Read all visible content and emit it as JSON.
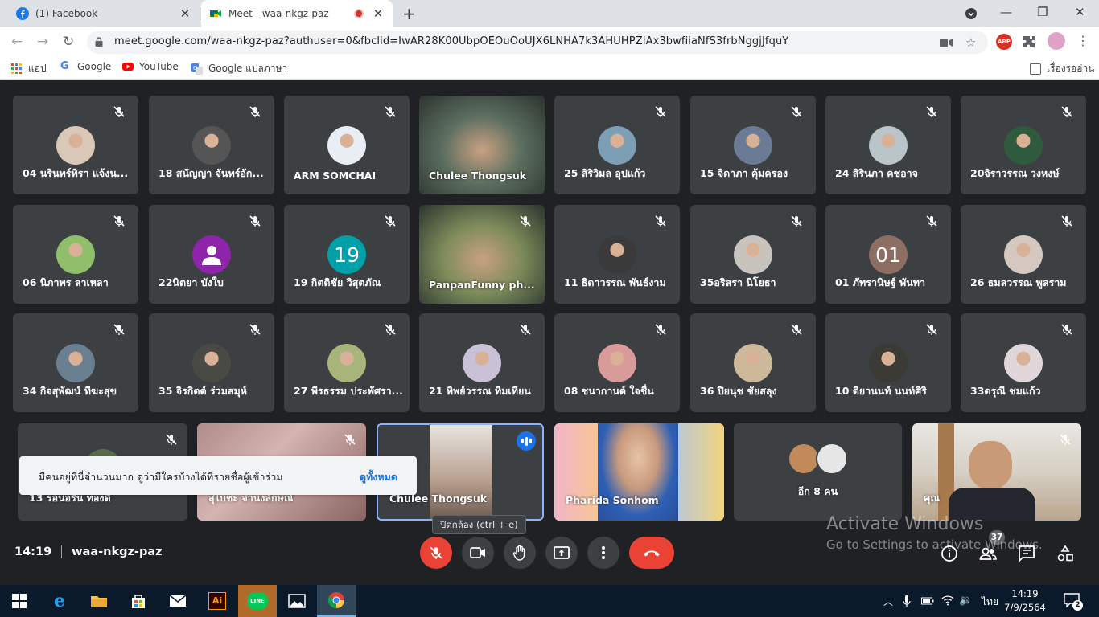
{
  "browser": {
    "tabs": [
      {
        "title": "(1) Facebook"
      },
      {
        "title": "Meet - waa-nkgz-paz"
      }
    ],
    "url": "meet.google.com/waa-nkgz-paz?authuser=0&fbclid=IwAR28K00UbpOEOuOoUJX6LNHA7k3AHUHPZIAx3bwfiiaNfS3frbNggjJfquY",
    "bookmarks": [
      "แอป",
      "Google",
      "YouTube",
      "Google แปลภาษา"
    ],
    "reading_list": "เรื่องรออ่าน",
    "extension_badge": "ABP"
  },
  "participants": [
    {
      "name": "04 นรินทร์ทิรา แจ้งน...",
      "avatar": "photo",
      "color": "#d9c7b8"
    },
    {
      "name": "18 สนัญญา จันทร์อัก...",
      "avatar": "photo",
      "color": "#555555"
    },
    {
      "name": "ARM SOMCHAI",
      "avatar": "photo",
      "color": "#e9eef5"
    },
    {
      "name": "Chulee Thongsuk",
      "avatar": "video",
      "color": "#5b6e5f"
    },
    {
      "name": "25 สิริวิมล อุปแก้ว",
      "avatar": "photo",
      "color": "#7d9fb6"
    },
    {
      "name": "15 จิดาภา คุ้มครอง",
      "avatar": "photo",
      "color": "#6b7b95"
    },
    {
      "name": "24 สิรินภา คชอาจ",
      "avatar": "photo",
      "color": "#b9c5c9"
    },
    {
      "name": "20จิราวรรณ วงหงษ์",
      "avatar": "photo",
      "color": "#2f5a3d"
    },
    {
      "name": "06 นิภาพร ลาเหลา",
      "avatar": "photo",
      "color": "#8fbf6a"
    },
    {
      "name": "22นิตยา บังใบ",
      "avatar": "icon",
      "color": "#8e24aa"
    },
    {
      "name": "19 กิตติชัย วิสุตภัณ",
      "avatar": "19",
      "color": "#00a0a8"
    },
    {
      "name": "PanpanFunny ph...",
      "avatar": "video",
      "color": "#7d8b5a"
    },
    {
      "name": "11 ธิดาวรรณ พันธ์งาม",
      "avatar": "photo",
      "color": "#3a3a3a"
    },
    {
      "name": "35อริสรา นิโยธา",
      "avatar": "photo",
      "color": "#c9c3bd"
    },
    {
      "name": "01 ภัทรานิษฐ์ พันทา",
      "avatar": "01",
      "color": "#8d6e63"
    },
    {
      "name": "26 ธมลวรรณ พูลราม",
      "avatar": "photo",
      "color": "#d5c8c0"
    },
    {
      "name": "34 กิจสุพัฒน์ ทีฆะสุข",
      "avatar": "photo",
      "color": "#6a7f8f"
    },
    {
      "name": "35 จิรกิตต์ ร่วมสมุห์",
      "avatar": "photo",
      "color": "#4a4a44"
    },
    {
      "name": "27 พีรธรรม ประพัศรา...",
      "avatar": "photo",
      "color": "#a8b57a"
    },
    {
      "name": "21 ทิพย์วรรณ ทิมเทียน",
      "avatar": "photo",
      "color": "#c9c1d6"
    },
    {
      "name": "08 ชนากานต์ ใจชื่น",
      "avatar": "photo",
      "color": "#d99a9a"
    },
    {
      "name": "36 ปิยนุช ชัยสลุง",
      "avatar": "photo",
      "color": "#cdb89a"
    },
    {
      "name": "10 ติยานนท์ นนท์ศิริ",
      "avatar": "photo",
      "color": "#3b3b35"
    },
    {
      "name": "33ดรุณี ชมแก้ว",
      "avatar": "photo",
      "color": "#e1d6da"
    }
  ],
  "bottom_row": {
    "tile1": "13 รอนอริน ทองดี",
    "tile2": "สุไบชะ จำนงลักษณ์",
    "tile3": "Chulee Thongsuk",
    "tile4": "Pharida Sonhom",
    "tile5": "อีก 8 คน",
    "tile6": "คุณ"
  },
  "toast": {
    "message": "มีคนอยู่ที่นี่จำนวนมาก ดูว่ามีใครบ้างได้ที่รายชื่อผู้เข้าร่วม",
    "action": "ดูทั้งหมด"
  },
  "tooltip": "ปิดกล้อง (ctrl + e)",
  "meeting": {
    "time": "14:19",
    "code": "waa-nkgz-paz",
    "participant_count": "37"
  },
  "watermark": {
    "line1": "Activate Windows",
    "line2": "Go to Settings to activate Windows."
  },
  "taskbar": {
    "language": "ไทย",
    "time": "14:19",
    "date": "7/9/2564",
    "notifications": "2"
  },
  "colors": {
    "meet_bg": "#202124",
    "tile_bg": "#3c4043",
    "hangup_red": "#ea4335",
    "accent_blue": "#1a73e8"
  }
}
